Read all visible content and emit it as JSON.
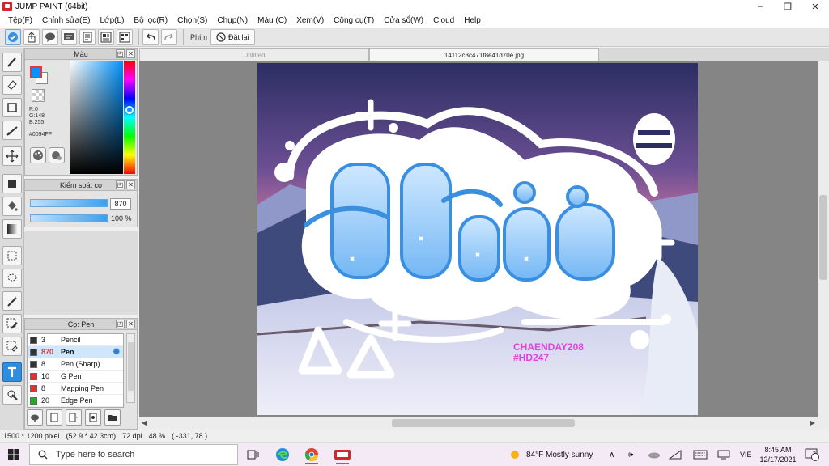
{
  "window": {
    "title": "JUMP PAINT (64bit)",
    "controls": [
      "–",
      "❐",
      "✕"
    ]
  },
  "menu": [
    "Tệp(F)",
    "Chỉnh sửa(E)",
    "Lớp(L)",
    "Bộ lọc(R)",
    "Chọn(S)",
    "Chụp(N)",
    "Màu (C)",
    "Xem(V)",
    "Công cụ(T)",
    "Cửa sổ(W)",
    "Cloud",
    "Help"
  ],
  "toolbar": {
    "key_label": "Phím",
    "reset_label": "Đặt lại"
  },
  "color_panel": {
    "title": "Màu",
    "r": "R:0",
    "g": "G:148",
    "b": "B:255",
    "hex": "#0094FF",
    "fg_color": "#0094FF",
    "bg_color": "#FFFFFF"
  },
  "brush_control": {
    "title": "Kiểm soát cọ",
    "size_value": "870",
    "opacity_value": "100 %"
  },
  "pen_panel": {
    "title": "Cọ: Pen",
    "items": [
      {
        "size": "3",
        "name": "Pencil",
        "color": "#333333"
      },
      {
        "size": "870",
        "name": "Pen",
        "color": "#333333",
        "selected": true
      },
      {
        "size": "8",
        "name": "Pen (Sharp)",
        "color": "#333333"
      },
      {
        "size": "10",
        "name": "G Pen",
        "color": "#e03030"
      },
      {
        "size": "8",
        "name": "Mapping Pen",
        "color": "#e03030"
      },
      {
        "size": "20",
        "name": "Edge Pen",
        "color": "#22aa22"
      }
    ]
  },
  "tabs": [
    "Untitled",
    "14112c3c471f8e41d70e.jpg"
  ],
  "artwork": {
    "watermark_line1": "CHAENDAY208",
    "watermark_line2": "#HD247"
  },
  "status": {
    "dimensions": "1500 * 1200 pixel",
    "physical": "(52.9 * 42.3cm)",
    "dpi": "72 dpi",
    "zoom": "48 %",
    "coords": "( -331, 78 )"
  },
  "taskbar": {
    "search_placeholder": "Type here to search",
    "weather": "84°F  Mostly sunny",
    "lang": "VIE",
    "time": "8:45 AM",
    "date": "12/17/2021",
    "notif_count": "2"
  }
}
